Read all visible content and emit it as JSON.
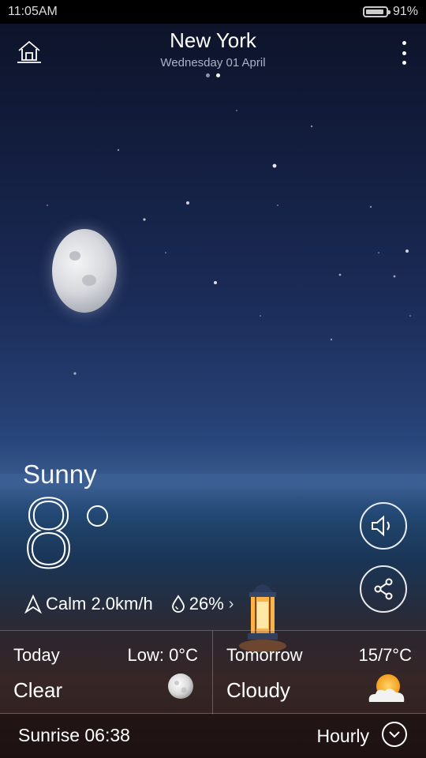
{
  "status_bar": {
    "time": "11:05AM",
    "battery": "91%"
  },
  "header": {
    "city": "New York",
    "date": "Wednesday 01 April",
    "page_count": 2,
    "active_page": 2
  },
  "current": {
    "condition": "Sunny",
    "temperature": "8",
    "wind": "Calm 2.0km/h",
    "humidity": "26%"
  },
  "forecast": {
    "today": {
      "label": "Today",
      "range": "Low: 0°C",
      "condition": "Clear",
      "icon": "moon-icon"
    },
    "tomorrow": {
      "label": "Tomorrow",
      "range": "15/7°C",
      "condition": "Cloudy",
      "icon": "partly-cloudy-icon"
    }
  },
  "bottom": {
    "sunrise": "Sunrise 06:38",
    "hourly_label": "Hourly"
  },
  "icons": [
    "home-icon",
    "more-icon",
    "speaker-icon",
    "share-icon",
    "wind-icon",
    "humidity-icon",
    "chevron-down-icon"
  ]
}
